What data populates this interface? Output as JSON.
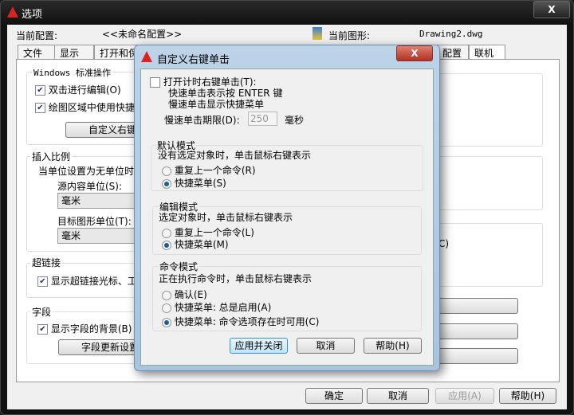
{
  "window": {
    "title": "选项",
    "close": "X"
  },
  "header": {
    "profile_label": "当前配置:",
    "profile_value": "<<未命名配置>>",
    "drawing_label": "当前图形:",
    "drawing_value": "Drawing2.dwg"
  },
  "tabs": [
    "文件",
    "显示",
    "打开和保",
    "配置",
    "联机"
  ],
  "left": {
    "windows_group": "Windows 标准操作",
    "dblclick": "双击进行编辑(O)",
    "shortcut": "绘图区域中使用快捷",
    "custom_btn": "自定义右键单",
    "insert_group": "插入比例",
    "unitless": "当单位设置为无单位时",
    "source_label": "源内容单位(S):",
    "source_value": "毫米",
    "target_label": "目标图形单位(T):",
    "target_value": "毫米",
    "hyperlink_group": "超链接",
    "hyperlink_cb": "显示超链接光标、工",
    "field_group": "字段",
    "field_cb": "显示字段的背景(B)",
    "field_btn": "字段更新设置"
  },
  "right": {
    "partial_c": "C)",
    "btn1": "..",
    "btn3": ".."
  },
  "footer": {
    "ok": "确定",
    "cancel": "取消",
    "apply": "应用(A)",
    "help": "帮助(H)"
  },
  "dialog": {
    "title": "自定义右键单击",
    "close": "X",
    "timed": "打开计时右键单击(T):",
    "quick": "快速单击表示按 ENTER 键",
    "slow": "慢速单击显示快捷菜单",
    "period_label": "慢速单击期限(D):",
    "period_value": "250",
    "period_unit": "毫秒",
    "default_group": "默认模式",
    "default_desc": "没有选定对象时，单击鼠标右键表示",
    "default_opts": [
      "重复上一个命令(R)",
      "快捷菜单(S)"
    ],
    "edit_group": "编辑模式",
    "edit_desc": "选定对象时，单击鼠标右键表示",
    "edit_opts": [
      "重复上一个命令(L)",
      "快捷菜单(M)"
    ],
    "cmd_group": "命令模式",
    "cmd_desc": "正在执行命令时，单击鼠标右键表示",
    "cmd_opts": [
      "确认(E)",
      "快捷菜单: 总是启用(A)",
      "快捷菜单: 命令选项存在时可用(C)"
    ],
    "apply_close": "应用并关闭",
    "cancel": "取消",
    "help": "帮助(H)"
  }
}
